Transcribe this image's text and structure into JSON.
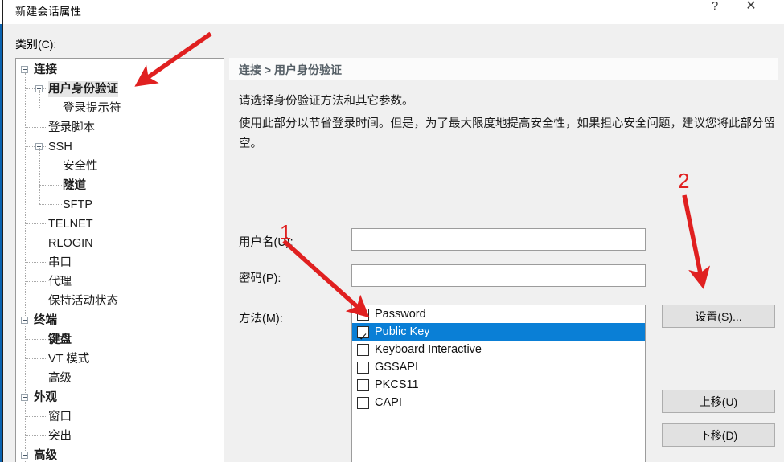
{
  "window": {
    "title": "新建会话属性",
    "help_button": "?",
    "close_button": "✕"
  },
  "sidebar": {
    "label": "类别(C):",
    "items": [
      {
        "label": "连接",
        "indent": 0,
        "toggle": "minus",
        "bold": true,
        "selected": false
      },
      {
        "label": "用户身份验证",
        "indent": 1,
        "toggle": "minus",
        "bold": true,
        "selected": true
      },
      {
        "label": "登录提示符",
        "indent": 2,
        "toggle": "none",
        "bold": false,
        "selected": false
      },
      {
        "label": "登录脚本",
        "indent": 1,
        "toggle": "none",
        "bold": false,
        "selected": false
      },
      {
        "label": "SSH",
        "indent": 1,
        "toggle": "minus",
        "bold": false,
        "selected": false
      },
      {
        "label": "安全性",
        "indent": 2,
        "toggle": "none",
        "bold": false,
        "selected": false
      },
      {
        "label": "隧道",
        "indent": 2,
        "toggle": "none",
        "bold": true,
        "selected": false
      },
      {
        "label": "SFTP",
        "indent": 2,
        "toggle": "none",
        "bold": false,
        "selected": false
      },
      {
        "label": "TELNET",
        "indent": 1,
        "toggle": "none",
        "bold": false,
        "selected": false
      },
      {
        "label": "RLOGIN",
        "indent": 1,
        "toggle": "none",
        "bold": false,
        "selected": false
      },
      {
        "label": "串口",
        "indent": 1,
        "toggle": "none",
        "bold": false,
        "selected": false
      },
      {
        "label": "代理",
        "indent": 1,
        "toggle": "none",
        "bold": false,
        "selected": false
      },
      {
        "label": "保持活动状态",
        "indent": 1,
        "toggle": "none",
        "bold": false,
        "selected": false
      },
      {
        "label": "终端",
        "indent": 0,
        "toggle": "minus",
        "bold": true,
        "selected": false
      },
      {
        "label": "键盘",
        "indent": 1,
        "toggle": "none",
        "bold": true,
        "selected": false
      },
      {
        "label": "VT 模式",
        "indent": 1,
        "toggle": "none",
        "bold": false,
        "selected": false
      },
      {
        "label": "高级",
        "indent": 1,
        "toggle": "none",
        "bold": false,
        "selected": false
      },
      {
        "label": "外观",
        "indent": 0,
        "toggle": "minus",
        "bold": true,
        "selected": false
      },
      {
        "label": "窗口",
        "indent": 1,
        "toggle": "none",
        "bold": false,
        "selected": false
      },
      {
        "label": "突出",
        "indent": 1,
        "toggle": "none",
        "bold": false,
        "selected": false
      },
      {
        "label": "高级",
        "indent": 0,
        "toggle": "minus",
        "bold": true,
        "selected": false
      }
    ]
  },
  "panel": {
    "breadcrumb": "连接 > 用户身份验证",
    "description_line1": "请选择身份验证方法和其它参数。",
    "description_line2": "使用此部分以节省登录时间。但是，为了最大限度地提高安全性，如果担心安全问题，建议您将此部分留空。",
    "username": {
      "label": "用户名(U):",
      "value": "",
      "placeholder": ""
    },
    "password": {
      "label": "密码(P):",
      "value": "",
      "placeholder": ""
    },
    "methods": {
      "label": "方法(M):",
      "items": [
        {
          "name": "Password",
          "checked": false,
          "selected": false
        },
        {
          "name": "Public Key",
          "checked": true,
          "selected": true
        },
        {
          "name": "Keyboard Interactive",
          "checked": false,
          "selected": false
        },
        {
          "name": "GSSAPI",
          "checked": false,
          "selected": false
        },
        {
          "name": "PKCS11",
          "checked": false,
          "selected": false
        },
        {
          "name": "CAPI",
          "checked": false,
          "selected": false
        }
      ]
    },
    "buttons": {
      "properties": "设置(S)...",
      "move_up": "上移(U)",
      "move_down": "下移(D)"
    }
  },
  "annotations": {
    "marker_1": "1",
    "marker_2": "2",
    "arrow_color": "#e02020"
  },
  "colors": {
    "selection_blue": "#0a7fd6",
    "window_accent": "#0b63b0",
    "dialog_background": "#f0f0f0",
    "annotation_red": "#e02020"
  }
}
